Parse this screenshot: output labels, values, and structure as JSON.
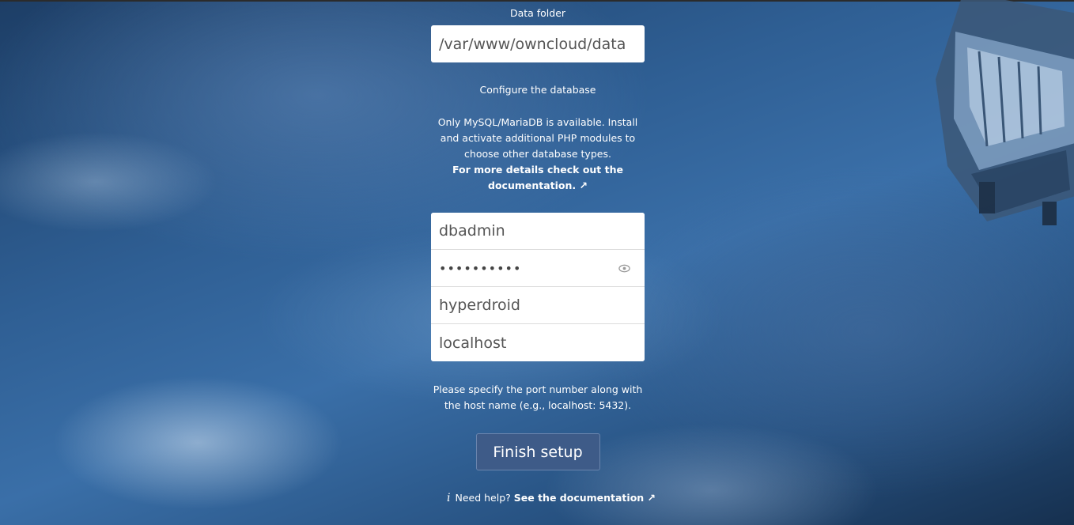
{
  "data_folder": {
    "label": "Data folder",
    "value": "/var/www/owncloud/data"
  },
  "database": {
    "heading": "Configure the database",
    "notice": "Only MySQL/MariaDB is available. Install and activate additional PHP modules to choose other database types.",
    "details_link": "For more details check out the documentation. ↗",
    "user": "dbadmin",
    "password_mask": "••••••••••",
    "name": "hyperdroid",
    "host": "localhost",
    "port_hint": "Please specify the port number along with the host name (e.g., localhost: 5432)."
  },
  "finish_button": "Finish setup",
  "help": {
    "icon": "info-icon",
    "prefix": "Need help?",
    "link": "See the documentation ↗"
  },
  "icons": {
    "password_toggle": "eye-icon"
  },
  "colors": {
    "button_bg": "#3e5b88",
    "accent_text": "#ffffff"
  }
}
